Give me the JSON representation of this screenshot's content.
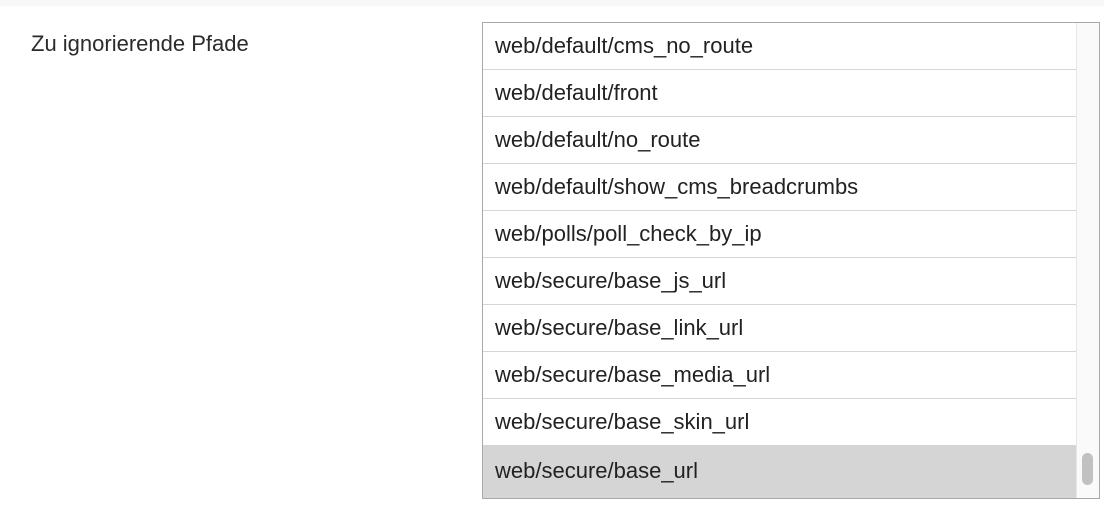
{
  "field": {
    "label": "Zu ignorierende Pfade"
  },
  "listbox": {
    "options": [
      {
        "label": "web/default/cms_no_route",
        "selected": false
      },
      {
        "label": "web/default/front",
        "selected": false
      },
      {
        "label": "web/default/no_route",
        "selected": false
      },
      {
        "label": "web/default/show_cms_breadcrumbs",
        "selected": false
      },
      {
        "label": "web/polls/poll_check_by_ip",
        "selected": false
      },
      {
        "label": "web/secure/base_js_url",
        "selected": false
      },
      {
        "label": "web/secure/base_link_url",
        "selected": false
      },
      {
        "label": "web/secure/base_media_url",
        "selected": false
      },
      {
        "label": "web/secure/base_skin_url",
        "selected": false
      },
      {
        "label": "web/secure/base_url",
        "selected": true
      }
    ],
    "selected_highlight_color": "#d5d5d5",
    "scroll_position": 0.93
  }
}
